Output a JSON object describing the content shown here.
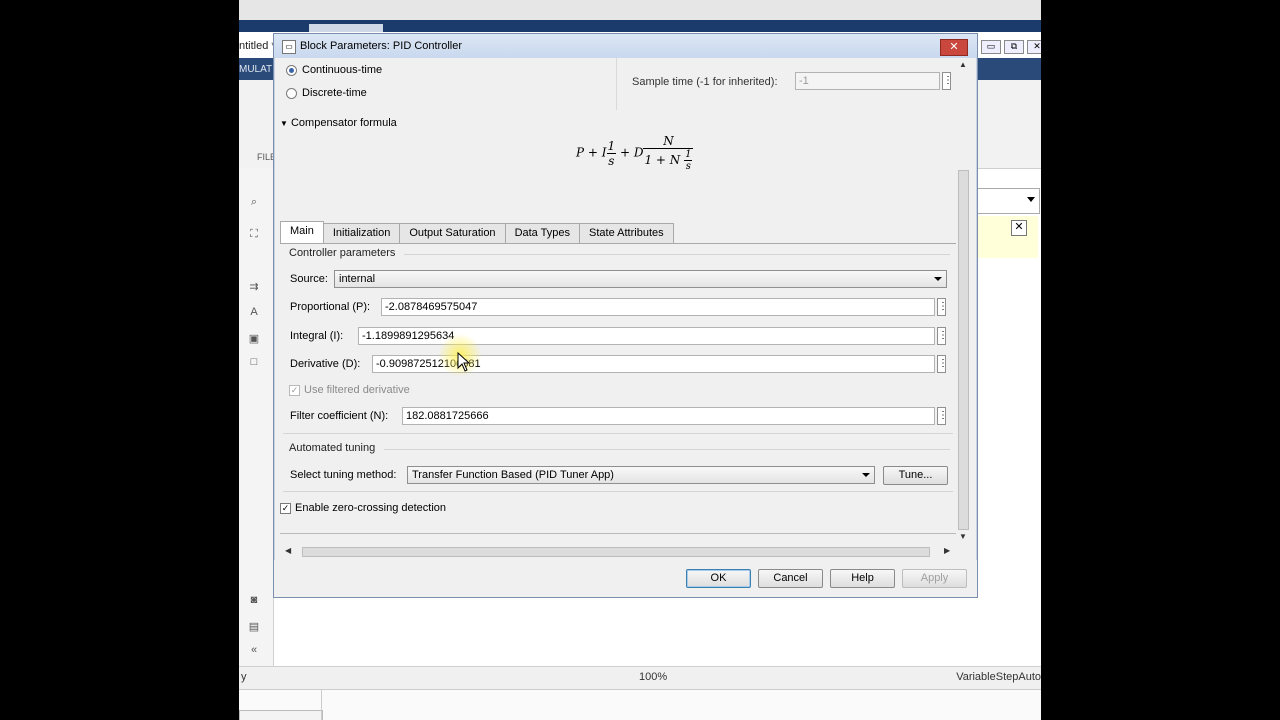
{
  "background": {
    "left_labels": [
      "ntitled *",
      "MULATI",
      "FILE"
    ],
    "status": {
      "left": "y",
      "zoom": "100%",
      "solver": "VariableStepAuto"
    },
    "window_buttons": [
      "▭",
      "⧉",
      "✕"
    ]
  },
  "dialog": {
    "title": "Block Parameters: PID Controller",
    "close": "✕",
    "time_domain": {
      "continuous": "Continuous-time",
      "discrete": "Discrete-time",
      "selected": "Continuous-time"
    },
    "sample_time": {
      "label": "Sample time (-1 for inherited):",
      "value": "-1"
    },
    "compensator_formula_label": "Compensator formula",
    "tabs": [
      "Main",
      "Initialization",
      "Output Saturation",
      "Data Types",
      "State Attributes"
    ],
    "active_tab": "Main",
    "controller_parameters": {
      "heading": "Controller parameters",
      "source_label": "Source:",
      "source_value": "internal",
      "proportional_label": "Proportional (P):",
      "proportional_value": "-2.0878469575047",
      "integral_label": "Integral (I):",
      "integral_value": "-1.1899891295634",
      "derivative_label": "Derivative (D):",
      "derivative_value": "-0.909872512100581",
      "filtered_derivative_label": "Use filtered derivative",
      "filter_label": "Filter coefficient (N):",
      "filter_value": "182.0881725666"
    },
    "automated_tuning": {
      "heading": "Automated tuning",
      "method_label": "Select tuning method:",
      "method_value": "Transfer Function Based (PID Tuner App)",
      "tune_button": "Tune..."
    },
    "zero_crossing_label": "Enable zero-crossing detection",
    "buttons": {
      "ok": "OK",
      "cancel": "Cancel",
      "help": "Help",
      "apply": "Apply"
    }
  }
}
